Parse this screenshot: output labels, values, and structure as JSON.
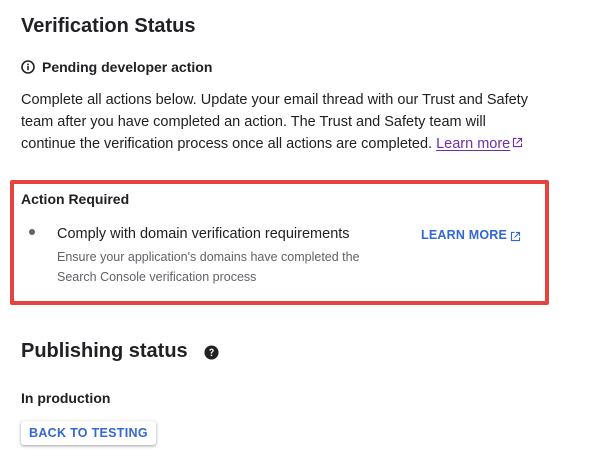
{
  "verification": {
    "title": "Verification Status",
    "pending_label": "Pending developer action",
    "description": "Complete all actions below. Update your email thread with our Trust and Safety team after you have completed an action. The Trust and Safety team will continue the verification process once all actions are completed.",
    "learn_more_link": "Learn more"
  },
  "action_required": {
    "title": "Action Required",
    "items": [
      {
        "title": "Comply with domain verification requirements",
        "description": "Ensure your application's domains have completed the Search Console verification process",
        "learn_more_label": "LEARN MORE"
      }
    ]
  },
  "publishing": {
    "title": "Publishing status",
    "status": "In production",
    "back_button_label": "BACK TO TESTING"
  },
  "colors": {
    "highlight_border": "#e5433f",
    "link_visited": "#6f2da8",
    "button_text": "#3367d6"
  },
  "icons": {
    "pending": "info-icon",
    "external_link": "open-in-new-icon",
    "help": "help-icon"
  }
}
